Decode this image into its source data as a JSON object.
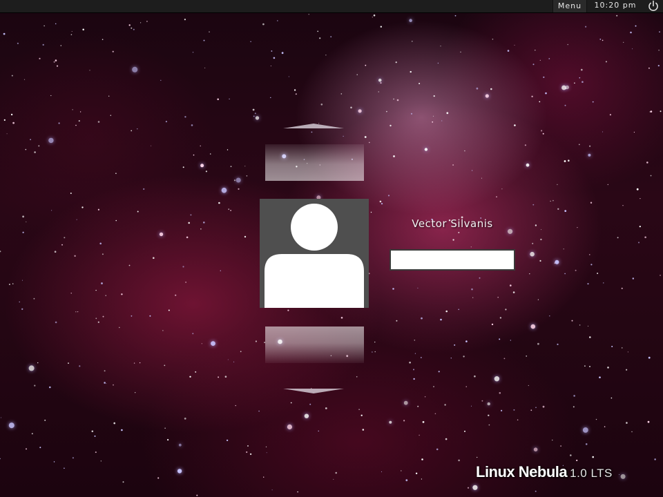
{
  "top_panel": {
    "menu_label": "Menu",
    "clock": "10:20 pm",
    "power_icon": "power-icon"
  },
  "login": {
    "user_name": "Vector Silvanis",
    "password_value": "",
    "avatar_icon": "user-silhouette-icon",
    "scroll_up_icon": "chevron-up-icon",
    "scroll_down_icon": "chevron-down-icon"
  },
  "branding": {
    "distro_name": "Linux Nebula",
    "version": "1.0 LTS"
  },
  "colors": {
    "panel_bg": "#1d1d1d",
    "avatar_bg": "#4f4f4f",
    "nebula_pink": "#d73c78"
  }
}
